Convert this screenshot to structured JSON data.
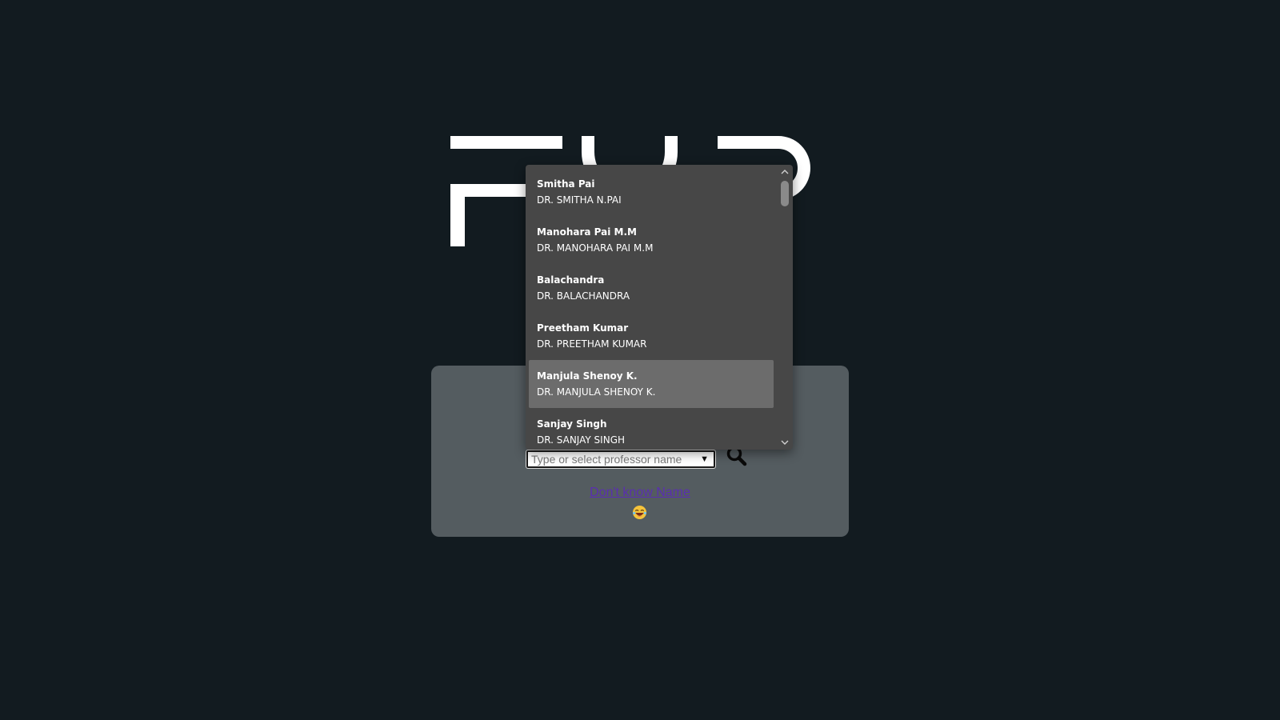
{
  "search": {
    "placeholder": "Type or select professor name",
    "dropdown_arrow": "▼"
  },
  "links": {
    "dont_know": "Don't know Name"
  },
  "dropdown": {
    "selected_index": 4,
    "options": [
      {
        "name": "Smitha Pai",
        "full_name": "DR. SMITHA N.PAI"
      },
      {
        "name": "Manohara Pai M.M",
        "full_name": "DR. MANOHARA PAI M.M"
      },
      {
        "name": "Balachandra",
        "full_name": "DR. BALACHANDRA"
      },
      {
        "name": "Preetham Kumar",
        "full_name": "DR. PREETHAM KUMAR"
      },
      {
        "name": "Manjula Shenoy K.",
        "full_name": "DR. MANJULA SHENOY K."
      },
      {
        "name": "Sanjay Singh",
        "full_name": "DR. SANJAY SINGH"
      }
    ],
    "scroll_up": "^",
    "scroll_down": "v"
  },
  "icons": {
    "search": "search-icon",
    "emoji": "laughing-face-emoji"
  },
  "colors": {
    "background": "#121b20",
    "card": "#545c60",
    "dropdown": "#474747",
    "selected_option": "#6c6c6c",
    "link": "#5a2fb0"
  }
}
